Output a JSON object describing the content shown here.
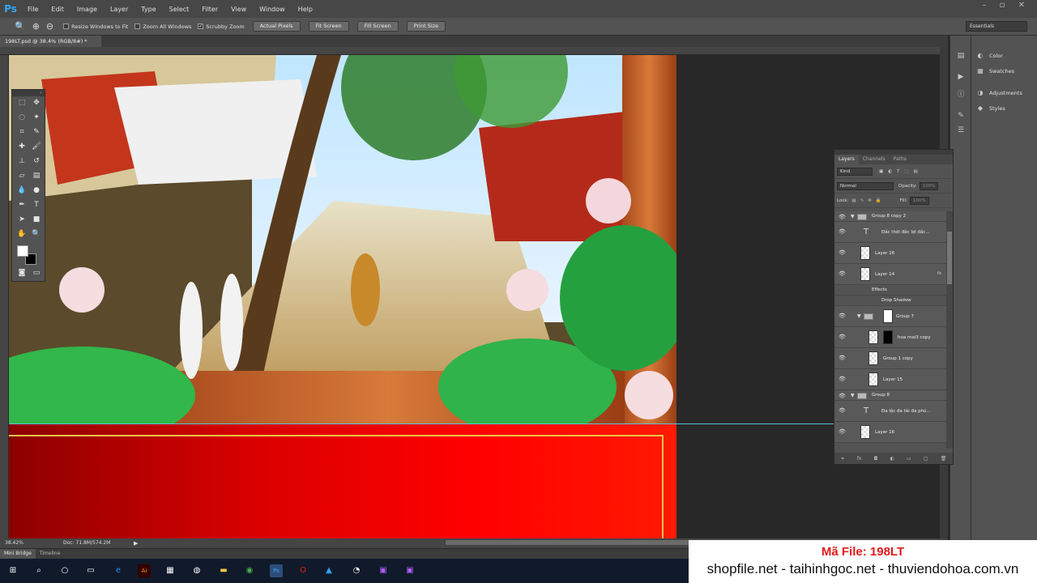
{
  "app": {
    "logo": "Ps"
  },
  "menu": [
    "File",
    "Edit",
    "Image",
    "Layer",
    "Type",
    "Select",
    "Filter",
    "View",
    "Window",
    "Help"
  ],
  "window_controls": [
    "–",
    "▫",
    "✕"
  ],
  "options_bar": {
    "checkboxes": [
      {
        "label": "Resize Windows to Fit",
        "checked": false
      },
      {
        "label": "Zoom All Windows",
        "checked": false
      },
      {
        "label": "Scrubby Zoom",
        "checked": true
      }
    ],
    "buttons": [
      "Actual Pixels",
      "Fit Screen",
      "Fill Screen",
      "Print Size"
    ],
    "workspace": "Essentials"
  },
  "document": {
    "tab_title": "198LT.psd @ 38.4% (RGB/8#) *"
  },
  "status": {
    "zoom": "38.42%",
    "doc": "Doc: 71.8M/574.2M"
  },
  "bottom_tabs": [
    "Mini Bridge",
    "Timeline"
  ],
  "panel_dock": {
    "items": [
      "Color",
      "Swatches",
      "Adjustments",
      "Styles"
    ]
  },
  "layers_panel": {
    "tabs": [
      "Layers",
      "Channels",
      "Paths"
    ],
    "filter": "Kind",
    "blend_mode": "Normal",
    "opacity_label": "Opacity:",
    "opacity_value": "100%",
    "lock_label": "Lock:",
    "fill_label": "Fill:",
    "fill_value": "100%",
    "layers": [
      {
        "name": "Group 8 copy 2",
        "kind": "group"
      },
      {
        "name": "Đắc thời đắc lợi đắc...",
        "kind": "text"
      },
      {
        "name": "Layer 16",
        "kind": "pixel"
      },
      {
        "name": "Layer 14",
        "kind": "pixel",
        "fx": "fx"
      },
      {
        "name": "Effects",
        "kind": "effects"
      },
      {
        "name": "Drop Shadow",
        "kind": "effect"
      },
      {
        "name": "Group 7",
        "kind": "group"
      },
      {
        "name": "hoa mai3 copy",
        "kind": "pixel"
      },
      {
        "name": "Group 1 copy",
        "kind": "pixel"
      },
      {
        "name": "Layer 15",
        "kind": "pixel"
      },
      {
        "name": "Group 8",
        "kind": "group"
      },
      {
        "name": "Đa lộc đa tài đa phú...",
        "kind": "text"
      },
      {
        "name": "Layer 16",
        "kind": "pixel"
      }
    ]
  },
  "watermark": {
    "code": "Mã File: 198LT",
    "sites": "shopfile.net - taihinhgoc.net - thuviendohoa.com.vn"
  },
  "colors": {
    "banner_red": "#ff0000",
    "gold_border": "#e8c34a",
    "guide": "#57c6d9",
    "ps_blue": "#31a8ff"
  },
  "taskbar_icons": [
    "windows-start-icon",
    "search-icon",
    "cortana-icon",
    "task-view-icon",
    "illustrator-icon",
    "app-icon",
    "globe-icon",
    "folder-icon",
    "chrome-icon",
    "photoshop-icon",
    "opera-icon",
    "app-icon",
    "app-icon",
    "app-icon",
    "app-icon"
  ]
}
